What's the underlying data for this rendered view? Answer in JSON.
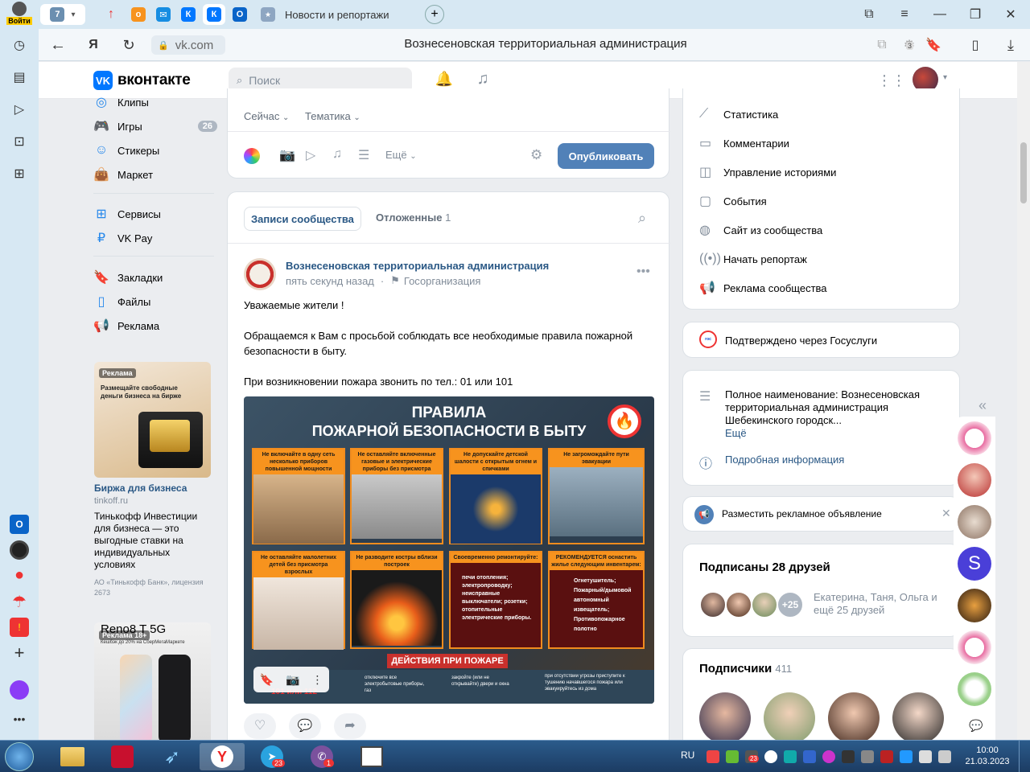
{
  "browser": {
    "tabs_count": "7",
    "signin_label": "Войти",
    "news_tab_label": "Новости и репортажи",
    "url_domain": "vk.com",
    "page_title": "Вознесеновская территориальная администрация",
    "downloads_badge": "3"
  },
  "vk": {
    "logo_text": "вконтакте",
    "search_placeholder": "Поиск",
    "left_menu": [
      {
        "label": "Клипы",
        "icon": "clips-icon"
      },
      {
        "label": "Игры",
        "icon": "gamepad-icon",
        "badge": "26"
      },
      {
        "label": "Стикеры",
        "icon": "smile-icon"
      },
      {
        "label": "Маркет",
        "icon": "bag-icon"
      },
      {
        "label": "Сервисы",
        "icon": "grid-icon"
      },
      {
        "label": "VK Pay",
        "icon": "ruble-icon"
      },
      {
        "label": "Закладки",
        "icon": "bookmark-icon"
      },
      {
        "label": "Файлы",
        "icon": "file-icon"
      },
      {
        "label": "Реклама",
        "icon": "megaphone-icon"
      }
    ],
    "ad1": {
      "badge": "Реклама",
      "image_text": "Размещайте свободные деньги бизнеса на бирже",
      "title": "Биржа для бизнеса",
      "domain": "tinkoff.ru",
      "text": "Тинькофф Инвестиции для бизнеса — это выгодные ставки на индивидуальных условиях",
      "legal": "АО «Тинькофф Банк», лицензия 2673"
    },
    "ad2": {
      "badge": "Реклама 18+",
      "title": "Reno8 T 5G",
      "subtitle": "Кешбэк до 20% на СберМегаМаркете"
    },
    "composer": {
      "now_label": "Сейчас",
      "topic_label": "Тематика",
      "more_label": "Ещё",
      "publish_label": "Опубликовать"
    },
    "feed_tabs": {
      "community_posts": "Записи сообщества",
      "postponed": "Отложенные",
      "postponed_count": "1"
    },
    "post": {
      "author": "Вознесеновская территориальная администрация",
      "time": "пять секунд назад",
      "org_type": "Госорганизация",
      "text_line1": "Уважаемые жители !",
      "text_line2": "Обращаемся к Вам с просьбой соблюдать все необходимые правила пожарной безопасности в быту.",
      "text_line3": "При возникновении пожара звонить по тел.: 01 или 101",
      "poster": {
        "title_line1": "ПРАВИЛА",
        "title_line2": "ПОЖАРНОЙ БЕЗОПАСНОСТИ В БЫТУ",
        "cells": [
          "Не включайте в одну сеть несколько приборов повышенной мощности",
          "Не оставляйте включенные газовые и электрические приборы без присмотра",
          "Не допускайте детской шалости с открытым огнем и спичками",
          "Не загромождайте пути эвакуации",
          "Не оставляйте малолетних детей без присмотра взрослых",
          "Не разводите костры вблизи построек",
          "Своевременно ремонтируйте:",
          "РЕКОМЕНДУЕТСЯ оснастить жилье следующим инвентарем:"
        ],
        "repair_list": "печи отопления; электропроводку; неисправные выключатели; розетки; отопительные электрические приборы.",
        "inventory_list": "Огнетушитель; Пожарный/дымовой автономный извещатель; Противопожарное полотно",
        "footer": "ДЕЙСТВИЯ ПРИ ПОЖАРЕ",
        "footer_items": [
          "отключите все электробытовые приборы, газ",
          "закройте (или не открывайте) двери и окна",
          "при отсутствии угрозы приступите к тушению начавшегося пожара или эвакуируйтесь из дома"
        ],
        "phones": "101 или 112"
      }
    },
    "right_menu": [
      {
        "label": "Статистика",
        "icon": "chart-icon"
      },
      {
        "label": "Комментарии",
        "icon": "comment-icon"
      },
      {
        "label": "Управление историями",
        "icon": "stories-icon"
      },
      {
        "label": "События",
        "icon": "calendar-icon"
      },
      {
        "label": "Сайт из сообщества",
        "icon": "globe-icon"
      },
      {
        "label": "Начать репортаж",
        "icon": "broadcast-icon"
      },
      {
        "label": "Реклама сообщества",
        "icon": "megaphone-icon"
      }
    ],
    "gosuslugi": "Подтверждено через Госуслуги",
    "info": {
      "full_name": "Полное наименование: Вознесеновская территориальная администрация Шебекинского городск...",
      "more": "Ещё",
      "details": "Подробная информация"
    },
    "ad_promo": "Разместить рекламное объявление",
    "friends": {
      "title": "Подписаны 28 друзей",
      "extra": "+25",
      "names": "Екатерина, Таня, Ольга и ещё 25 друзей"
    },
    "subscribers": {
      "title": "Подписчики",
      "count": "411"
    }
  },
  "taskbar": {
    "lang": "RU",
    "time": "10:00",
    "date": "21.03.2023",
    "telegram_badge": "23",
    "viber_badge": "1",
    "tray_badge": "23"
  },
  "colors": {
    "vk_blue": "#0077ff",
    "button_blue": "#5181b8",
    "link_blue": "#2a5885",
    "poster_orange": "#f7931e"
  }
}
